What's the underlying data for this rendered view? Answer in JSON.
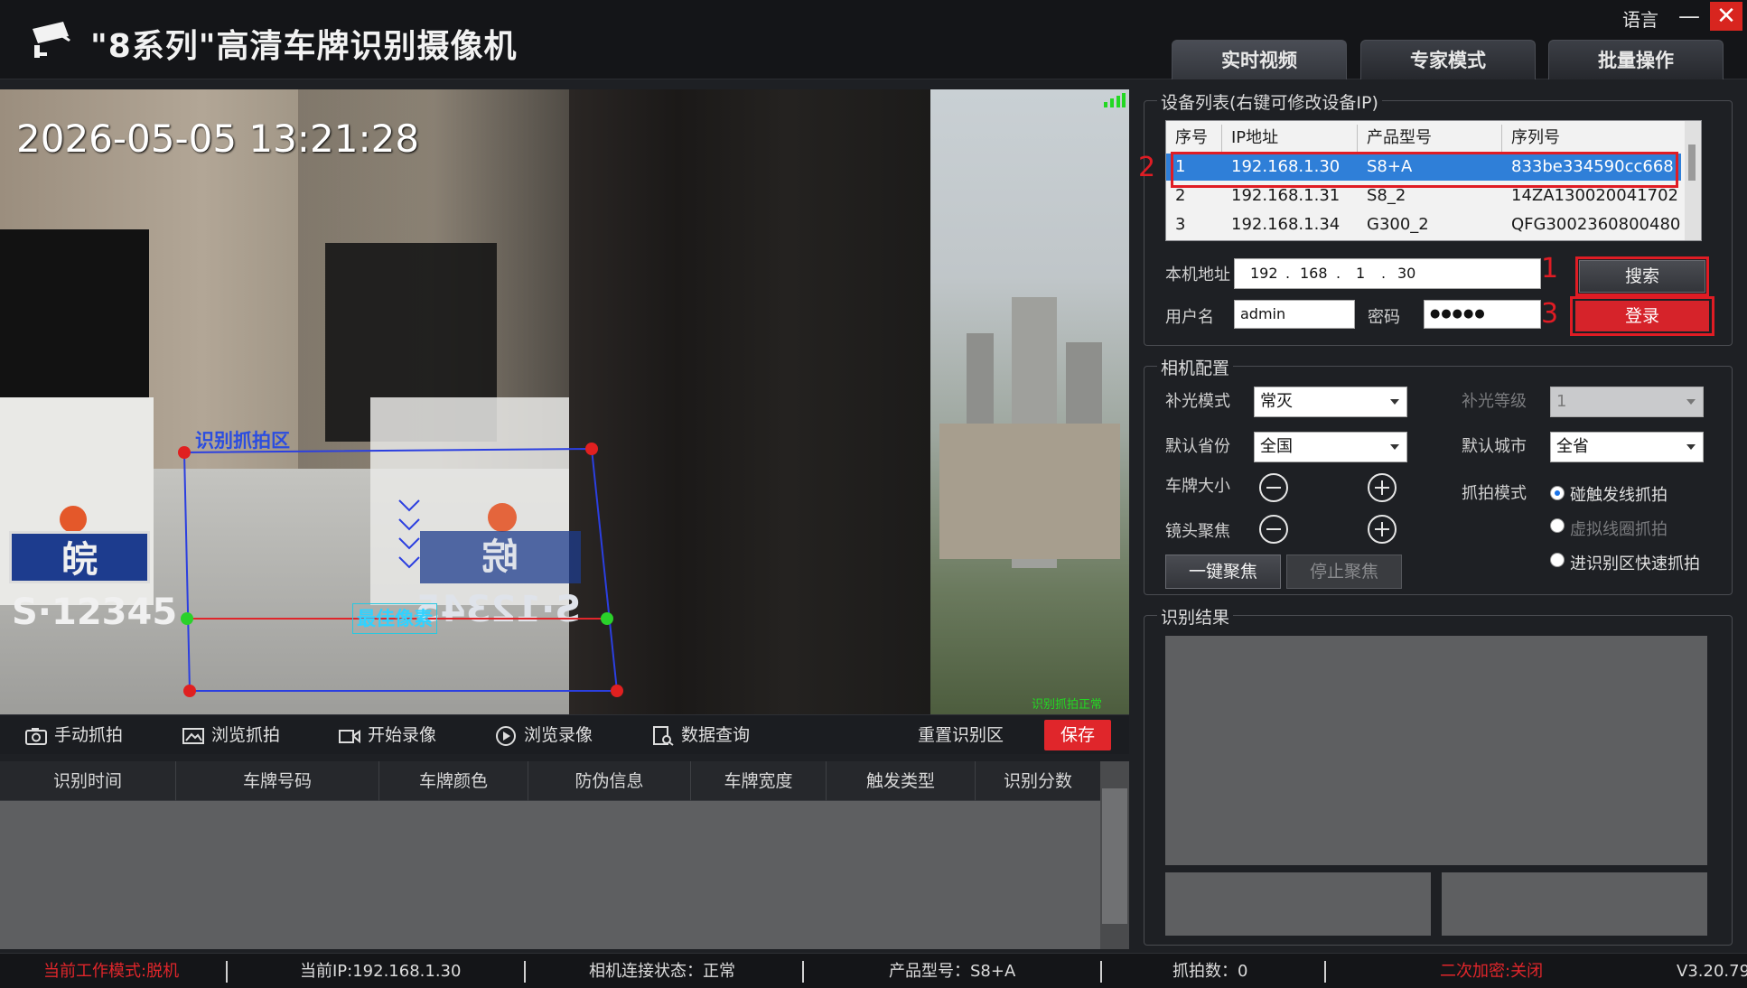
{
  "app": {
    "title": "\"8系列\"高清车牌识别摄像机",
    "language": "语言",
    "minimize": "—",
    "close": "✕"
  },
  "tabs": [
    {
      "label": "实时视频",
      "active": true
    },
    {
      "label": "专家模式",
      "active": false
    },
    {
      "label": "批量操作",
      "active": false
    }
  ],
  "video": {
    "timestamp": "2026-05-05 13:21:28",
    "zone_label": "识别抓拍区",
    "best_pixel_label": "最佳像素",
    "plate_text_left": "皖S·12345",
    "plate_text_right": "皖S·12345",
    "status_text": "识别抓拍正常",
    "zone_color": "#2b3fe0",
    "line_color": "#e0262b"
  },
  "toolbar": {
    "manual_capture": "手动抓拍",
    "browse_capture": "浏览抓拍",
    "start_record": "开始录像",
    "browse_record": "浏览录像",
    "data_query": "数据查询",
    "reset_zone": "重置识别区",
    "save": "保存"
  },
  "results_table": {
    "columns": [
      "识别时间",
      "车牌号码",
      "车牌颜色",
      "防伪信息",
      "车牌宽度",
      "触发类型",
      "识别分数"
    ],
    "rows": []
  },
  "status_bar": {
    "work_mode": "当前工作模式:脱机",
    "current_ip": "当前IP:192.168.1.30",
    "connection": "相机连接状态：正常",
    "model": "产品型号：S8+A",
    "capture_count": "抓拍数：0",
    "encryption": "二次加密:关闭",
    "version": "V3.20.79"
  },
  "device_list": {
    "group_label": "设备列表(右键可修改设备IP)",
    "columns": [
      "序号",
      "IP地址",
      "产品型号",
      "序列号"
    ],
    "rows": [
      {
        "index": "1",
        "ip": "192.168.1.30",
        "model": "S8+A",
        "serial": "833be334590cc668",
        "selected": true
      },
      {
        "index": "2",
        "ip": "192.168.1.31",
        "model": "S8_2",
        "serial": "14ZA130020041702",
        "selected": false
      },
      {
        "index": "3",
        "ip": "192.168.1.34",
        "model": "G300_2",
        "serial": "QFG3002360800480",
        "selected": false
      }
    ],
    "local_address_label": "本机地址",
    "ip_parts": [
      "192",
      "168",
      "1",
      "30"
    ],
    "username_label": "用户名",
    "username": "admin",
    "password_label": "密码",
    "password_mask": "●●●●●",
    "search_button": "搜索",
    "login_button": "登录",
    "annotations": [
      "1",
      "2",
      "3"
    ],
    "annotation_color": "#e01c24"
  },
  "camera_config": {
    "group_label": "相机配置",
    "fill_light_mode_label": "补光模式",
    "fill_light_mode": "常灭",
    "fill_light_level_label": "补光等级",
    "fill_light_level": "1",
    "default_province_label": "默认省份",
    "default_province": "全国",
    "default_city_label": "默认城市",
    "default_city": "全省",
    "plate_size_label": "车牌大小",
    "focus_label": "镜头聚焦",
    "capture_mode_label": "抓拍模式",
    "capture_modes": [
      {
        "label": "碰触发线抓拍",
        "selected": true,
        "enabled": true
      },
      {
        "label": "虚拟线圈抓拍",
        "selected": false,
        "enabled": false
      },
      {
        "label": "进识别区快速抓拍",
        "selected": false,
        "enabled": true
      }
    ],
    "one_key_focus": "一键聚焦",
    "stop_focus": "停止聚焦"
  },
  "recognition_result": {
    "group_label": "识别结果"
  }
}
